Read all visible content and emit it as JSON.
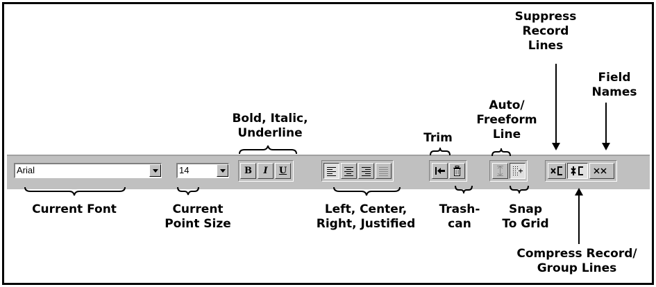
{
  "toolbar": {
    "font_value": "Arial",
    "size_value": "14",
    "bold_label": "B",
    "italic_label": "I",
    "underline_label": "U"
  },
  "labels": {
    "suppress_record_lines": "Suppress\nRecord\nLines",
    "field_names": "Field\nNames",
    "bold_italic_underline": "Bold, Italic,\nUnderline",
    "auto_freeform_line": "Auto/\nFreeform\nLine",
    "trim": "Trim",
    "current_font": "Current Font",
    "current_point_size": "Current\nPoint Size",
    "alignment": "Left, Center,\nRight, Justified",
    "trashcan": "Trash-\ncan",
    "snap_to_grid": "Snap\nTo Grid",
    "compress_record_group_lines": "Compress Record/\nGroup Lines"
  },
  "icons": {
    "align_left": "align-left-icon",
    "align_center": "align-center-icon",
    "align_right": "align-right-icon",
    "align_justify": "align-justify-icon",
    "trim": "trim-icon",
    "trashcan": "trashcan-icon",
    "auto_line": "auto-line-icon",
    "snap_grid": "snap-to-grid-icon",
    "suppress": "suppress-record-lines-icon",
    "compress": "compress-record-lines-icon",
    "field_names": "field-names-icon"
  }
}
